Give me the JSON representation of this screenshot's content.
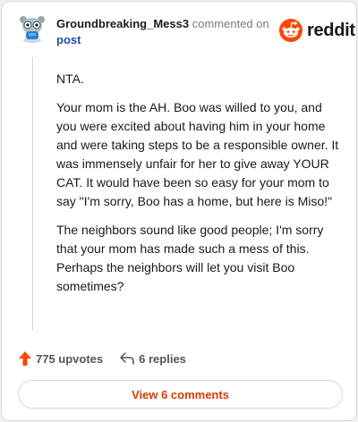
{
  "header": {
    "username": "Groundbreaking_Mess3",
    "commented_on": "commented on",
    "post_link": "post"
  },
  "brand": {
    "name": "reddit",
    "color": "#ff4500"
  },
  "comment": {
    "paragraphs": [
      "NTA.",
      "Your mom is the AH. Boo was willed to you, and you were excited about having him in your home and were taking steps to be a responsible owner. It was immensely unfair for her to give away YOUR CAT. It would have been so easy for your mom to say \"I'm sorry, Boo has a home, but here is Miso!\"",
      "The neighbors sound like good people; I'm sorry that your mom has made such a mess of this. Perhaps the neighbors will let you visit Boo sometimes?"
    ]
  },
  "actions": {
    "upvotes": "775 upvotes",
    "replies": "6 replies",
    "upvote_color": "#ff4500"
  },
  "view_comments": "View 6 comments",
  "icons": {
    "avatar": "snoo-avatar-icon",
    "brand": "reddit-logo-icon",
    "upvote": "upvote-arrow-icon",
    "reply": "reply-arrow-icon"
  }
}
